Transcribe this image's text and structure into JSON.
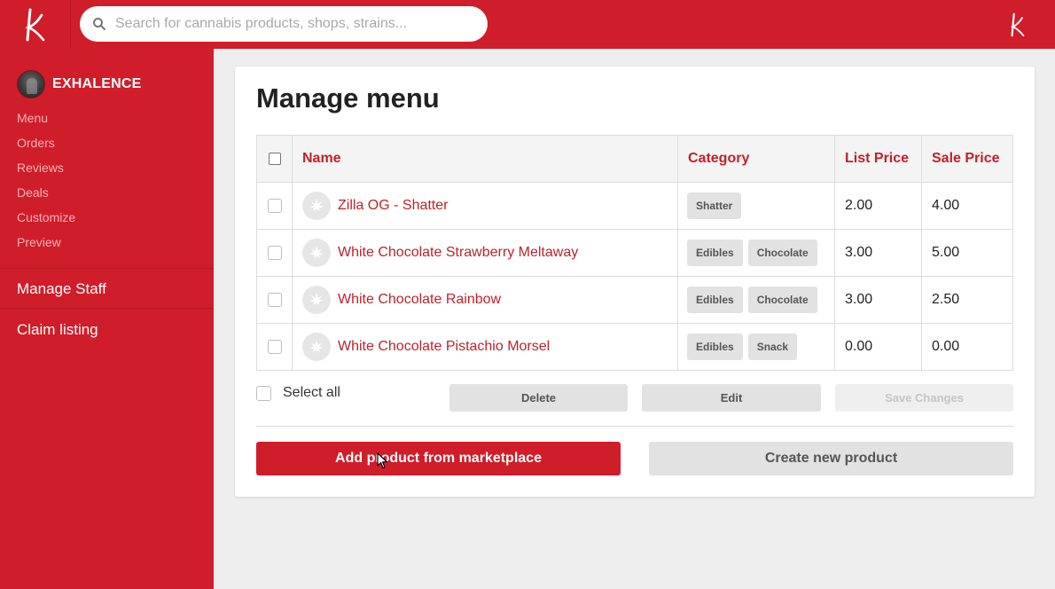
{
  "brand": {
    "logo_letter": "k",
    "logo_right_letter": "k"
  },
  "search": {
    "placeholder": "Search for cannabis products, shops, strains..."
  },
  "sidebar": {
    "shop_name": "EXHALENCE",
    "links": [
      "Menu",
      "Orders",
      "Reviews",
      "Deals",
      "Customize",
      "Preview"
    ],
    "manage_staff": "Manage Staff",
    "claim_listing": "Claim listing"
  },
  "page": {
    "title": "Manage menu",
    "columns": {
      "name": "Name",
      "category": "Category",
      "list_price": "List Price",
      "sale_price": "Sale Price"
    },
    "rows": [
      {
        "name": "Zilla OG - Shatter",
        "tags": [
          "Shatter"
        ],
        "list_price": "2.00",
        "sale_price": "4.00"
      },
      {
        "name": "White Chocolate Strawberry Meltaway",
        "tags": [
          "Edibles",
          "Chocolate"
        ],
        "list_price": "3.00",
        "sale_price": "5.00"
      },
      {
        "name": "White Chocolate Rainbow",
        "tags": [
          "Edibles",
          "Chocolate"
        ],
        "list_price": "3.00",
        "sale_price": "2.50"
      },
      {
        "name": "White Chocolate Pistachio Morsel",
        "tags": [
          "Edibles",
          "Snack"
        ],
        "list_price": "0.00",
        "sale_price": "0.00"
      }
    ],
    "select_all": "Select all",
    "actions": {
      "delete": "Delete",
      "edit": "Edit",
      "save": "Save Changes"
    },
    "add_from_marketplace": "Add product from marketplace",
    "create_new": "Create new product"
  },
  "colors": {
    "brand_red": "#d01d2a",
    "link_red": "#c0212c"
  },
  "icons": {
    "search": "search-icon",
    "row_thumb": "cannabis-leaf-icon",
    "cursor": "mouse-pointer-icon"
  }
}
